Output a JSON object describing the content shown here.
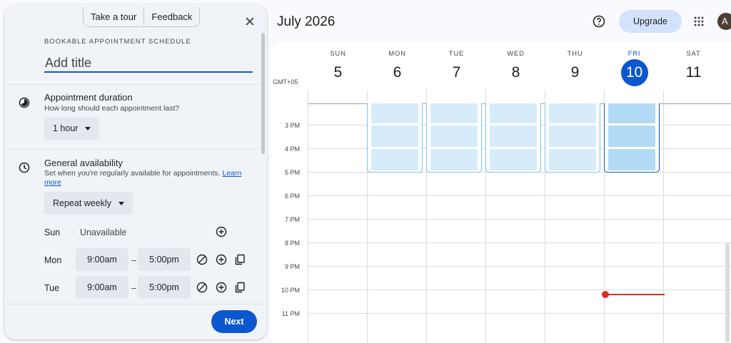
{
  "panel": {
    "tabs": [
      "Take a tour",
      "Feedback"
    ],
    "close_icon": "close-icon",
    "kicker": "BOOKABLE APPOINTMENT SCHEDULE",
    "title_placeholder": "Add title",
    "duration": {
      "title": "Appointment duration",
      "subtitle": "How long should each appointment last?",
      "value": "1 hour",
      "icon": "duration-icon"
    },
    "availability": {
      "title": "General availability",
      "subtitle": "Set when you're regularly available for appointments.",
      "learn_more": "Learn more",
      "repeat": "Repeat weekly",
      "icon": "clock-icon",
      "days": [
        {
          "name": "Sun",
          "status": "Unavailable"
        },
        {
          "name": "Mon",
          "start": "9:00am",
          "end": "5:00pm"
        },
        {
          "name": "Tue",
          "start": "9:00am",
          "end": "5:00pm"
        }
      ],
      "dash": "–"
    },
    "next_label": "Next"
  },
  "header": {
    "month": "July 2026",
    "upgrade_label": "Upgrade",
    "avatar_initial": "A"
  },
  "calendar": {
    "timezone": "GMT+05",
    "days": [
      {
        "dow": "SUN",
        "num": "5"
      },
      {
        "dow": "MON",
        "num": "6"
      },
      {
        "dow": "TUE",
        "num": "7"
      },
      {
        "dow": "WED",
        "num": "8"
      },
      {
        "dow": "THU",
        "num": "9"
      },
      {
        "dow": "FRI",
        "num": "10",
        "today": true
      },
      {
        "dow": "SAT",
        "num": "11"
      }
    ],
    "hours": [
      "3 PM",
      "4 PM",
      "5 PM",
      "6 PM",
      "7 PM",
      "8 PM",
      "9 PM",
      "10 PM",
      "11 PM"
    ],
    "colors": {
      "accent": "#0b57d0",
      "slot": "#d7ecfa",
      "now": "#d93025"
    }
  }
}
